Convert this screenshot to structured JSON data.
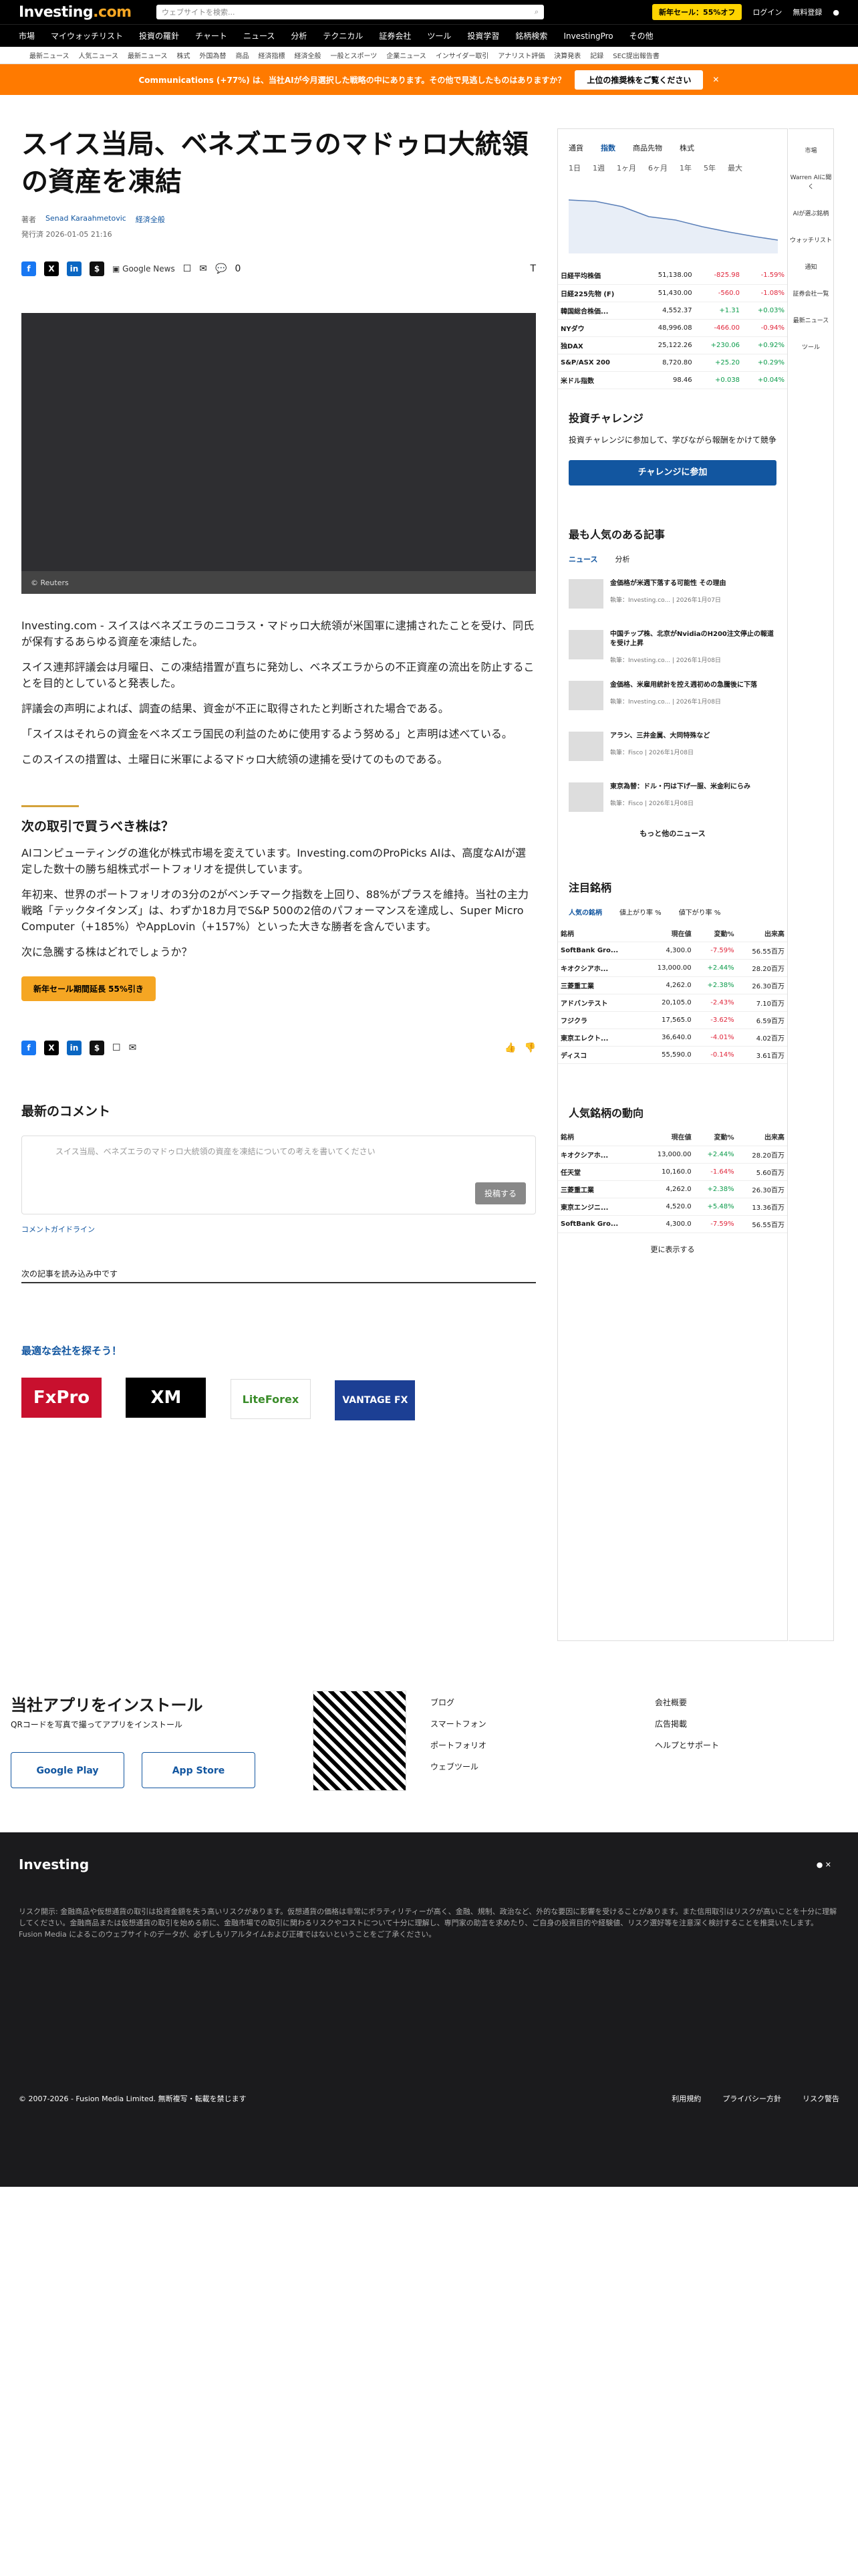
{
  "header": {
    "logo": "Investing",
    "logo_tld": ".com",
    "search_placeholder": "ウェブサイトを検索...",
    "sale": "新年セール：55%オフ",
    "login": "ログイン",
    "register": "無料登録"
  },
  "nav": [
    "市場",
    "マイウォッチリスト",
    "投資の羅針",
    "チャート",
    "ニュース",
    "分析",
    "テクニカル",
    "証券会社",
    "ツール",
    "投資学習",
    "銘柄検索",
    "InvestingPro",
    "その他"
  ],
  "subnav": [
    "最新ニュース",
    "人気ニュース",
    "最新ニュース",
    "株式",
    "外国為替",
    "商品",
    "経済指標",
    "経済全般",
    "一般とスポーツ",
    "企業ニュース",
    "インサイダー取引",
    "アナリスト評価",
    "決算発表",
    "記録",
    "SEC提出報告書"
  ],
  "banner": {
    "text": "Communications (+77%) は、当社AIが今月選択した戦略の中にあります。その他で見逃したものはありますか？",
    "button": "上位の推奨株をご覧ください"
  },
  "article": {
    "title": "スイス当局、ベネズエラのマドゥロ大統領の資産を凍結",
    "author_label": "著者",
    "author": "Senad Karaahmetovic",
    "category": "経済全般",
    "date": "発行済 2026-01-05 21:16",
    "comments": "0",
    "caption": "© Reuters",
    "paragraphs": [
      "Investing.com - スイスはベネズエラのニコラス・マドゥロ大統領が米国軍に逮捕されたことを受け、同氏が保有するあらゆる資産を凍結した。",
      "スイス連邦評議会は月曜日、この凍結措置が直ちに発効し、ベネズエラからの不正資産の流出を防止することを目的としていると発表した。",
      "評議会の声明によれば、調査の結果、資金が不正に取得されたと判断された場合である。",
      "「スイスはそれらの資金をベネズエラ国民の利益のために使用するよう努める」と声明は述べている。",
      "このスイスの措置は、土曜日に米軍によるマドゥロ大統領の逮捕を受けてのものである。"
    ]
  },
  "promo": {
    "title": "次の取引で買うべき株は？",
    "p1": "AIコンピューティングの進化が株式市場を変えています。Investing.comのProPicks AIは、高度なAIが選定した数十の勝ち組株式ポートフォリオを提供しています。",
    "p2": "年初来、世界のポートフォリオの3分の2がベンチマーク指数を上回り、88%がプラスを維持。当社の主力戦略「テックタイタンズ」は、わずか18カ月でS&P 500の2倍のパフォーマンスを達成し、Super Micro Computer（+185%）やAppLovin（+157%）といった大きな勝者を含んでいます。",
    "p3": "次に急騰する株はどれでしょうか？",
    "cta": "新年セール期間延長 55%引き"
  },
  "comments": {
    "title": "最新のコメント",
    "placeholder": "スイス当局、ベネズエラのマドゥロ大統領の資産を凍結についての考えを書いてください",
    "post": "投稿する",
    "guide": "コメントガイドライン",
    "continue": "次の記事を読み込み中です"
  },
  "brokers": {
    "title": "最適な会社を探そう！",
    "list": [
      "FxPro",
      "XM",
      "LiteForex",
      "VANTAGE FX"
    ]
  },
  "market": {
    "tabs": [
      "通貨",
      "指数",
      "商品先物",
      "株式"
    ],
    "tf": [
      "1日",
      "1週",
      "1ヶ月",
      "6ヶ月",
      "1年",
      "5年",
      "最大"
    ],
    "rows": [
      [
        "日経平均株価",
        "51,138.00",
        "-825.98",
        "-1.59%"
      ],
      [
        "日経225先物 (F)",
        "51,430.00",
        "-560.0",
        "-1.08%"
      ],
      [
        "韓国総合株価...",
        "4,552.37",
        "+1.31",
        "+0.03%"
      ],
      [
        "NYダウ",
        "48,996.08",
        "-466.00",
        "-0.94%"
      ],
      [
        "独DAX",
        "25,122.26",
        "+230.06",
        "+0.92%"
      ],
      [
        "S&P/ASX 200",
        "8,720.80",
        "+25.20",
        "+0.29%"
      ],
      [
        "米ドル指数",
        "98.46",
        "+0.038",
        "+0.04%"
      ]
    ]
  },
  "challenge": {
    "title": "投資チャレンジ",
    "text": "投資チャレンジに参加して、学びながら報酬をかけて競争",
    "button": "チャレンジに参加"
  },
  "popular": {
    "title": "最も人気のある記事",
    "tabs": [
      "ニュース",
      "分析"
    ],
    "items": [
      [
        "金価格が米週下落する可能性 その理由",
        "Investing.co...",
        "2026年1月07日"
      ],
      [
        "中国チップ株、北京がNvidiaのH200注文停止の報道を受け上昇",
        "Investing.co...",
        "2026年1月08日"
      ],
      [
        "金価格、米雇用統計を控え週初めの急騰後に下落",
        "Investing.co...",
        "2026年1月08日"
      ],
      [
        "アラン、三井金属、大同特殊など",
        "Fisco",
        "2026年1月08日"
      ],
      [
        "東京為替：ドル・円は下げ一服、米金利にらみ",
        "Fisco",
        "2026年1月08日"
      ]
    ],
    "more": "もっと他のニュース"
  },
  "watch": {
    "title": "注目銘柄",
    "tabs": [
      "人気の銘柄",
      "値上がり率 %",
      "値下がり率 %"
    ],
    "head": [
      "銘柄",
      "現在値",
      "変動%",
      "出来高"
    ],
    "rows": [
      [
        "SoftBank Gro...",
        "4,300.0",
        "-7.59%",
        "56.55百万"
      ],
      [
        "キオクシアホ...",
        "13,000.00",
        "+2.44%",
        "28.20百万"
      ],
      [
        "三菱重工業",
        "4,262.0",
        "+2.38%",
        "26.30百万"
      ],
      [
        "アドバンテスト",
        "20,105.0",
        "-2.43%",
        "7.10百万"
      ],
      [
        "フジクラ",
        "17,565.0",
        "-3.62%",
        "6.59百万"
      ],
      [
        "東京エレクト...",
        "36,640.0",
        "-4.01%",
        "4.02百万"
      ],
      [
        "ディスコ",
        "55,590.0",
        "-0.14%",
        "3.61百万"
      ]
    ]
  },
  "trend": {
    "title": "人気銘柄の動向",
    "rows": [
      [
        "キオクシアホ...",
        "13,000.00",
        "+2.44%",
        "28.20百万"
      ],
      [
        "任天堂",
        "10,160.0",
        "-1.64%",
        "5.60百万"
      ],
      [
        "三菱重工業",
        "4,262.0",
        "+2.38%",
        "26.30百万"
      ],
      [
        "東京エンジニ...",
        "4,520.0",
        "+5.48%",
        "13.36百万"
      ],
      [
        "SoftBank Gro...",
        "4,300.0",
        "-7.59%",
        "56.55百万"
      ]
    ],
    "more": "更に表示する"
  },
  "rail": [
    "市場",
    "Warren AIに聞く",
    "AIが選ぶ銘柄",
    "ウォッチリスト",
    "通知",
    "証券会社一覧",
    "最新ニュース",
    "ツール"
  ],
  "app": {
    "title": "当社アプリをインストール",
    "sub": "QRコードを写真で撮ってアプリをインストール",
    "gp": "Google Play",
    "as": "App Store",
    "links1": [
      "ブログ",
      "スマートフォン",
      "ポートフォリオ",
      "ウェブツール"
    ],
    "links2": [
      "会社概要",
      "広告掲載",
      "ヘルプとサポート"
    ]
  },
  "footer": {
    "risk": "リスク開示: 金融商品や仮想通貨の取引は投資金額を失う高いリスクがあります。仮想通貨の価格は非常にボラティリティーが高く、金融、規制、政治など、外的な要因に影響を受けることがあります。また信用取引はリスクが高いことを十分に理解してください。金融商品または仮想通貨の取引を始める前に、金融市場での取引に関わるリスクやコストについて十分に理解し、専門家の助言を求めたり、ご自身の投資目的や経験値、リスク選好等を注意深く検討することを推奨いたします。Fusion Media によるこのウェブサイトのデータが、必ずしもリアルタイムおよび正確ではないということをご了承ください。",
    "copy": "© 2007-2026 - Fusion Media Limited. 無断複写・転載を禁じます",
    "l1": "利用規約",
    "l2": "プライバシー方針",
    "l3": "リスク警告"
  }
}
